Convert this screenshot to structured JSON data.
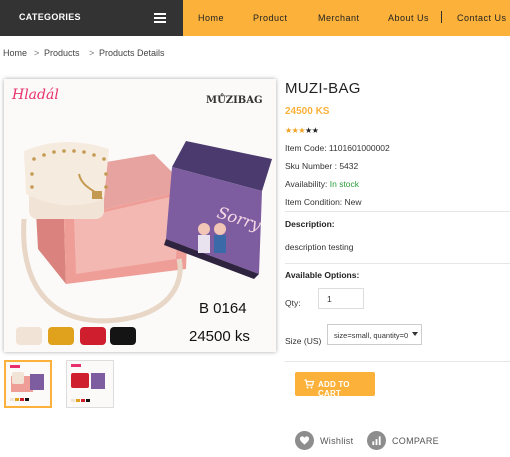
{
  "header": {
    "categories_label": "CATEGORIES",
    "nav": [
      "Home",
      "Product",
      "Merchant",
      "About Us",
      "Contact Us"
    ]
  },
  "breadcrumb": [
    "Home",
    "Products",
    "Products Details"
  ],
  "product": {
    "image": {
      "brand": "Hladál",
      "bag_brand": "MŮZIBAG",
      "box_text": "Sorry",
      "code": "B 0164",
      "price_tag": "24500 ks"
    },
    "title": "MUZI-BAG",
    "price": "24500 KS",
    "rating": 3,
    "max_rating": 5,
    "item_code": "Item Code: 1101601000002",
    "sku": "Sku Number : 5432",
    "availability_label": "Availability:",
    "availability_value": "In stock",
    "condition": "Item Condition: New",
    "description_heading": "Description:",
    "description_text": "description testing",
    "options_heading": "Available Options:",
    "qty_label": "Qty:",
    "qty_value": "1",
    "size_label": "Size (US)",
    "size_value": "size=small, quantity=0",
    "add_to_cart": "ADD TO CART",
    "wishlist": "Wishlist",
    "compare": "COMPARE"
  },
  "colors": {
    "accent": "#fbb13a",
    "dark": "#333333",
    "in_stock": "#2a9b3a",
    "brand_pink": "#e8306e"
  }
}
